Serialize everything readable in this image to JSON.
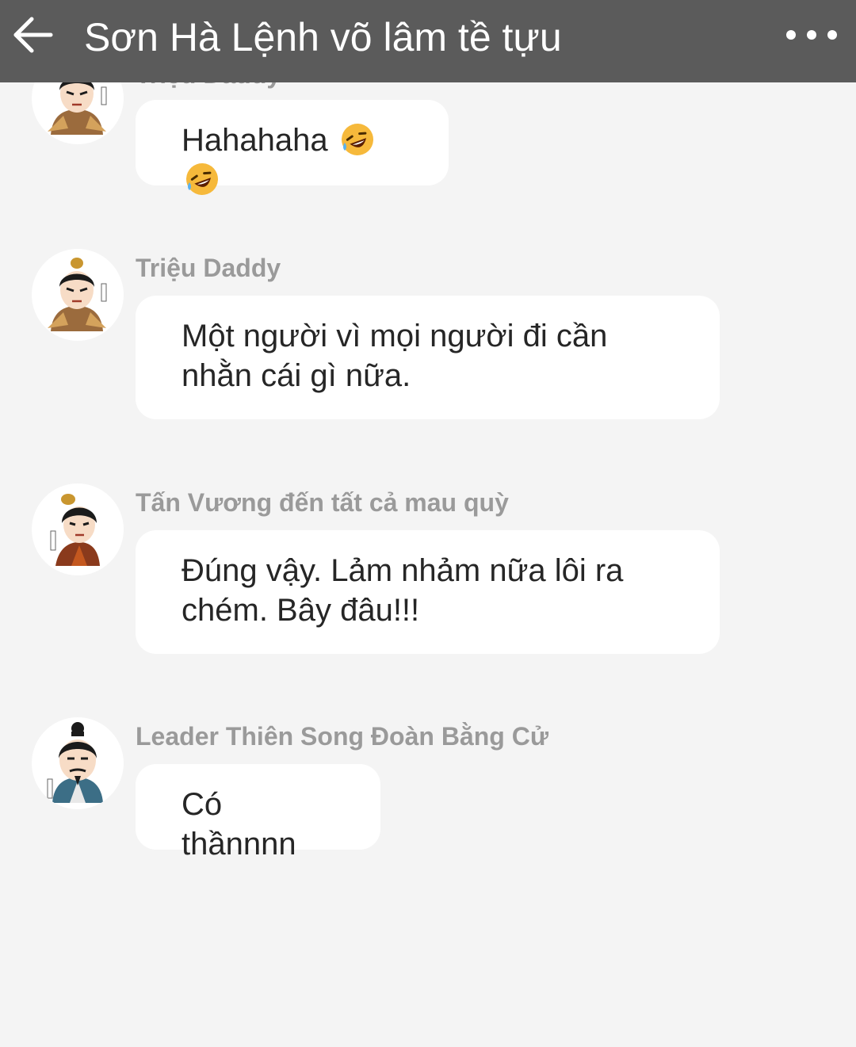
{
  "header": {
    "title": "Sơn Hà Lệnh võ lâm tề tựu",
    "back_icon": "arrow-left-icon",
    "more_icon": "more-horizontal-icon"
  },
  "colors": {
    "header_bg": "#5b5b5b",
    "chat_bg": "#f4f4f4",
    "bubble_bg": "#ffffff",
    "sender_text": "#9a9a9a",
    "message_text": "#262626"
  },
  "messages": [
    {
      "sender": "Triệu Daddy",
      "text": "Hahahaha",
      "emojis": [
        "rofl-emoji",
        "rofl-emoji"
      ],
      "avatar": "warrior-avatar-brown-robe"
    },
    {
      "sender": "Triệu Daddy",
      "text": "Một người vì mọi người đi cần nhằn cái gì nữa.",
      "avatar": "warrior-avatar-brown-robe"
    },
    {
      "sender": "Tấn Vương đến tất cả mau quỳ",
      "text": "Đúng vậy. Lảm nhảm nữa lôi ra chém. Bây đâu!!!",
      "avatar": "king-avatar-red-robe"
    },
    {
      "sender": "Leader Thiên Song Đoàn Bằng Cử",
      "text": "Có thầnnnn",
      "avatar": "scholar-avatar-blue-robe"
    }
  ]
}
